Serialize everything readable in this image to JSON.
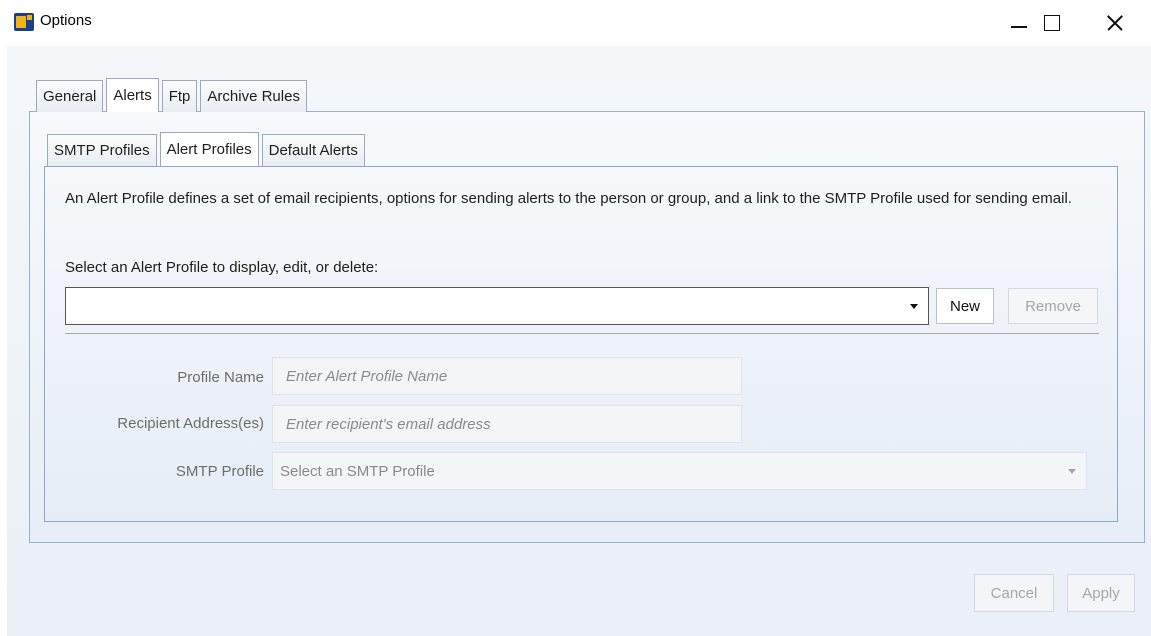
{
  "window": {
    "title": "Options",
    "icon": "app-logo-icon"
  },
  "outer_tabs": [
    {
      "label": "General",
      "active": false
    },
    {
      "label": "Alerts",
      "active": true
    },
    {
      "label": "Ftp",
      "active": false
    },
    {
      "label": "Archive Rules",
      "active": false
    }
  ],
  "inner_tabs": [
    {
      "label": "SMTP Profiles",
      "active": false
    },
    {
      "label": "Alert Profiles",
      "active": true
    },
    {
      "label": "Default Alerts",
      "active": false
    }
  ],
  "alert_profiles": {
    "description": "An Alert Profile defines a set of email recipients, options for sending alerts to the person or group, and a link to the SMTP Profile used for sending email.",
    "select_label": "Select an Alert Profile to display, edit, or delete:",
    "selected_value": "",
    "new_label": "New",
    "remove_label": "Remove",
    "profile_name_label": "Profile Name",
    "profile_name_placeholder": "Enter Alert Profile Name",
    "recipient_label": "Recipient Address(es)",
    "recipient_placeholder": "Enter recipient's email address",
    "smtp_label": "SMTP Profile",
    "smtp_placeholder": "Select an SMTP Profile"
  },
  "footer": {
    "cancel_label": "Cancel",
    "apply_label": "Apply"
  },
  "colors": {
    "panel_border": "#8fa6cc",
    "icon_blue": "#1a3f8c",
    "icon_gold": "#f0b31a"
  }
}
